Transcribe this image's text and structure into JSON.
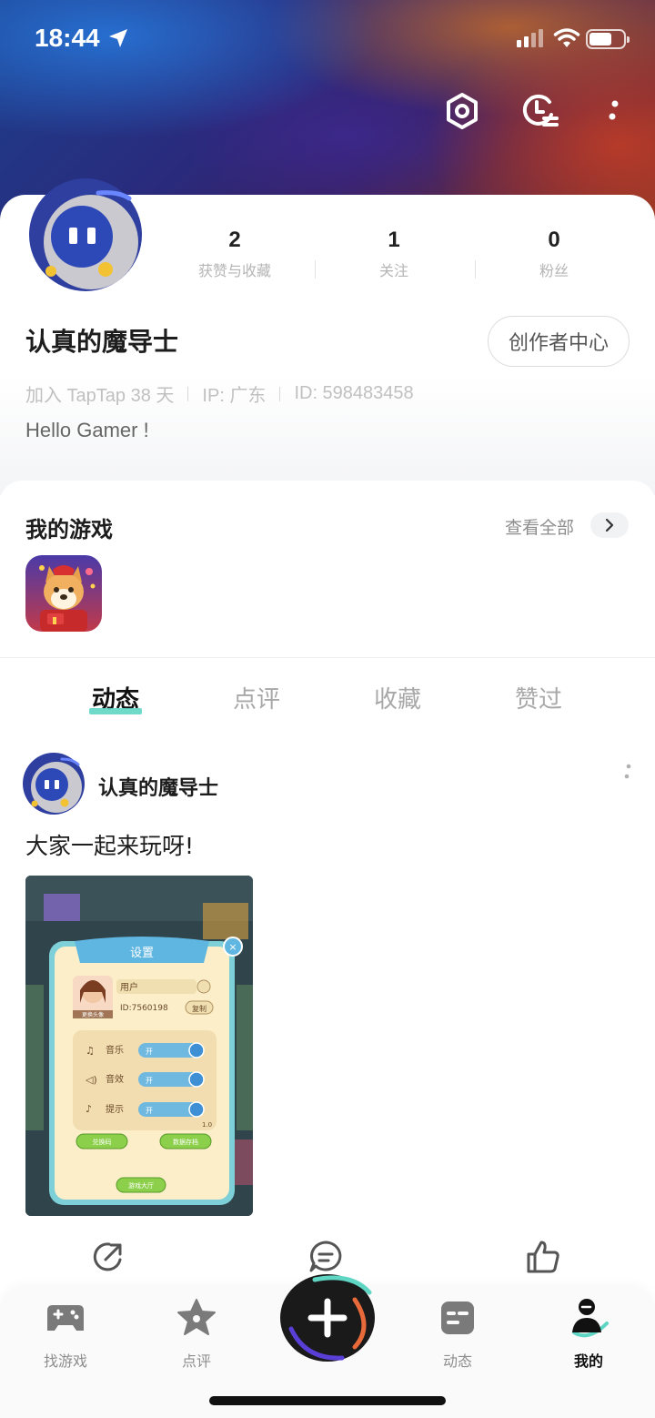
{
  "status_bar": {
    "time": "18:44"
  },
  "profile": {
    "username": "认真的魔导士",
    "creator_button": "创作者中心",
    "stats": [
      {
        "value": "2",
        "label": "获赞与收藏"
      },
      {
        "value": "1",
        "label": "关注"
      },
      {
        "value": "0",
        "label": "粉丝"
      }
    ],
    "meta": {
      "joined": "加入 TapTap 38 天",
      "ip": "IP: 广东",
      "id": "ID: 598483458"
    },
    "bio": "Hello Gamer !"
  },
  "my_games": {
    "title": "我的游戏",
    "see_all": "查看全部"
  },
  "tabs": [
    {
      "label": "动态",
      "active": true
    },
    {
      "label": "点评",
      "active": false
    },
    {
      "label": "收藏",
      "active": false
    },
    {
      "label": "赞过",
      "active": false
    }
  ],
  "post": {
    "author": "认真的魔导士",
    "text": "大家一起来玩呀!",
    "image": {
      "dialog_title": "设置",
      "user_label": "用户",
      "user_id": "ID:7560198",
      "copy_label": "复制",
      "avatar_caption": "更换头像",
      "settings": [
        {
          "label": "音乐",
          "value": "开"
        },
        {
          "label": "音效",
          "value": "开"
        },
        {
          "label": "提示",
          "value": "开"
        }
      ],
      "version": "1.0",
      "button_redeem": "兑换码",
      "button_save": "数据存档",
      "button_lobby": "游戏大厅"
    }
  },
  "bottom_nav": [
    {
      "label": "找游戏",
      "icon": "gamepad-icon"
    },
    {
      "label": "点评",
      "icon": "star-icon"
    },
    {
      "label": "动态",
      "icon": "feed-icon"
    },
    {
      "label": "我的",
      "icon": "profile-icon",
      "active": true
    }
  ],
  "colors": {
    "accent": "#5fd6c4",
    "text_primary": "#1d1d1d",
    "text_muted": "#c0c0c0"
  }
}
